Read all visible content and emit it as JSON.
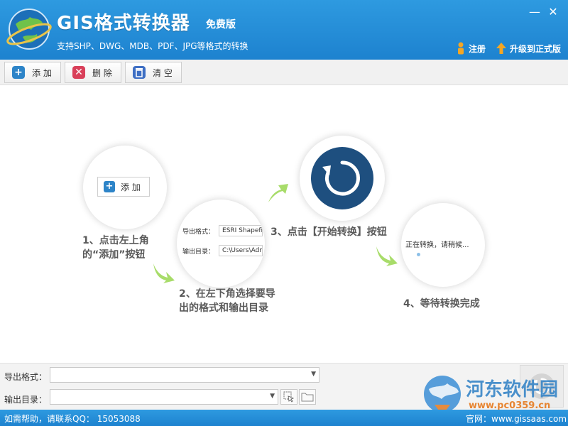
{
  "header": {
    "title": "GIS格式转换器",
    "edition": "免费版",
    "subtitle": "支持SHP、DWG、MDB、PDF、JPG等格式的转换",
    "minimize": "—",
    "close": "✕",
    "register": "注册",
    "upgrade": "升级到正式版"
  },
  "toolbar": {
    "add": "添 加",
    "delete": "删 除",
    "clear": "清 空"
  },
  "guide": {
    "mini_add": "添 加",
    "mini_export_label": "导出格式：",
    "mini_export_value": "ESRI Shapefile",
    "mini_outdir_label": "输出目录：",
    "mini_outdir_value": "C:\\Users\\Adm",
    "converting": "正在转换，请稍候...",
    "step1_line1": "1、点击左上角",
    "step1_line2": "的“添加”按钮",
    "step2_line1": "2、在左下角选择要导",
    "step2_line2": "出的格式和输出目录",
    "step3": "3、点击【开始转换】按钮",
    "step4": "4、等待转换完成"
  },
  "bottom": {
    "export_format_label": "导出格式：",
    "export_format_value": "",
    "output_dir_label": "输出目录：",
    "output_dir_value": ""
  },
  "status": {
    "help": "如需帮助，请联系QQ： 15053088",
    "website": "官网：www.gissaas.com"
  },
  "watermark": {
    "name": "河东软件园",
    "url": "www.pc0359.cn"
  },
  "colors": {
    "header_blue": "#1d82cf",
    "add_icon": "#2d84c8",
    "delete_icon": "#d9405a",
    "clear_icon": "#3e6fc4",
    "arrow_green": "#a8dc6a",
    "refresh_disk": "#1e4f7f"
  }
}
